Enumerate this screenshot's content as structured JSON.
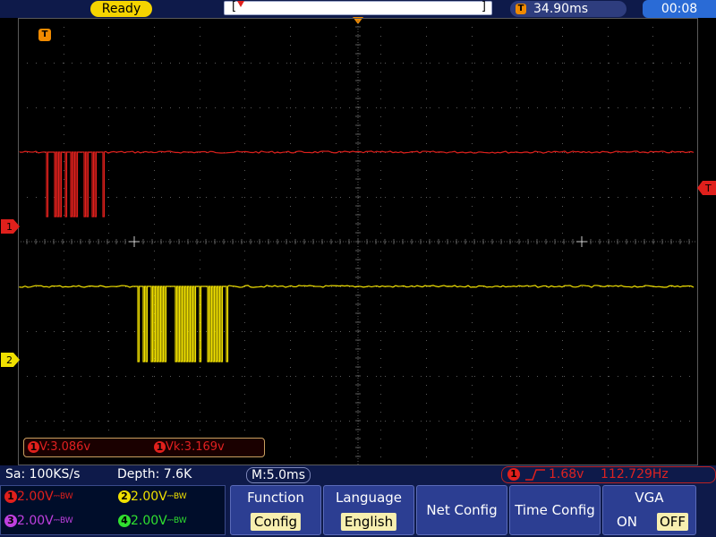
{
  "status": "Ready",
  "trigger_position": "34.90ms",
  "clock": "00:08",
  "marker_t": "T",
  "ch1_marker": "1",
  "ch2_marker": "2",
  "measurements": [
    {
      "channel": "1",
      "label": "V:3.086v"
    },
    {
      "channel": "1",
      "label": "Vk:3.169v"
    }
  ],
  "sample_rate": "Sa: 100KS/s",
  "depth": "Depth: 7.6K",
  "timebase": "M:5.0ms",
  "trigger": {
    "channel": "1",
    "level": "1.68v",
    "frequency": "112.729Hz"
  },
  "channels": [
    {
      "num": "1",
      "scale": "2.00V",
      "bw": "BW",
      "color": "#e0201c"
    },
    {
      "num": "2",
      "scale": "2.00V",
      "bw": "BW",
      "color": "#f0e000"
    },
    {
      "num": "3",
      "scale": "2.00V",
      "bw": "BW",
      "color": "#c040e0"
    },
    {
      "num": "4",
      "scale": "2.00V",
      "bw": "BW",
      "color": "#30e030"
    }
  ],
  "menu": {
    "function": {
      "title": "Function",
      "value": "Config"
    },
    "language": {
      "title": "Language",
      "value": "English"
    },
    "net_config": "Net Config",
    "time_config": "Time Config",
    "vga": {
      "title": "VGA",
      "on": "ON",
      "off": "OFF"
    }
  },
  "colors": {
    "ch1": "#e0201c",
    "ch2": "#f0e000",
    "grid": "#5a5a5a",
    "trigger": "#f08a00"
  }
}
